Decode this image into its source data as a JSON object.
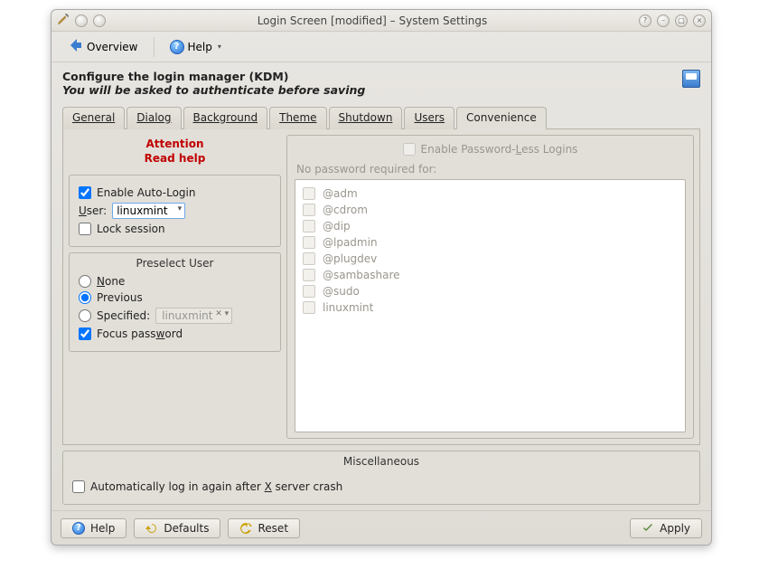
{
  "titlebar": {
    "title": "Login Screen [modified] – System Settings"
  },
  "toolbar": {
    "overview": "Overview",
    "help": "Help"
  },
  "header": {
    "title": "Configure the login manager (KDM)",
    "subtitle": "You will be asked to authenticate before saving"
  },
  "tabs": {
    "general": "General",
    "dialog": "Dialog",
    "background": "Background",
    "theme": "Theme",
    "shutdown": "Shutdown",
    "users": "Users",
    "convenience": "Convenience"
  },
  "attention": {
    "line1": "Attention",
    "line2": "Read help"
  },
  "autologin": {
    "enable_label": "Enable Auto-Login",
    "user_label": "User:",
    "user_value": "linuxmint",
    "lock_label": "Lock session"
  },
  "preselect": {
    "title": "Preselect User",
    "none": "None",
    "previous": "Previous",
    "specified": "Specified:",
    "specified_value": "linuxmint",
    "focus_password": "Focus password"
  },
  "passwordless": {
    "enable_label": "Enable Password-Less Logins",
    "list_label": "No password required for:",
    "items": [
      "@adm",
      "@cdrom",
      "@dip",
      "@lpadmin",
      "@plugdev",
      "@sambashare",
      "@sudo",
      "linuxmint"
    ]
  },
  "misc": {
    "title": "Miscellaneous",
    "auto_relogin": "Automatically log in again after X server crash"
  },
  "footer": {
    "help": "Help",
    "defaults": "Defaults",
    "reset": "Reset",
    "apply": "Apply"
  }
}
